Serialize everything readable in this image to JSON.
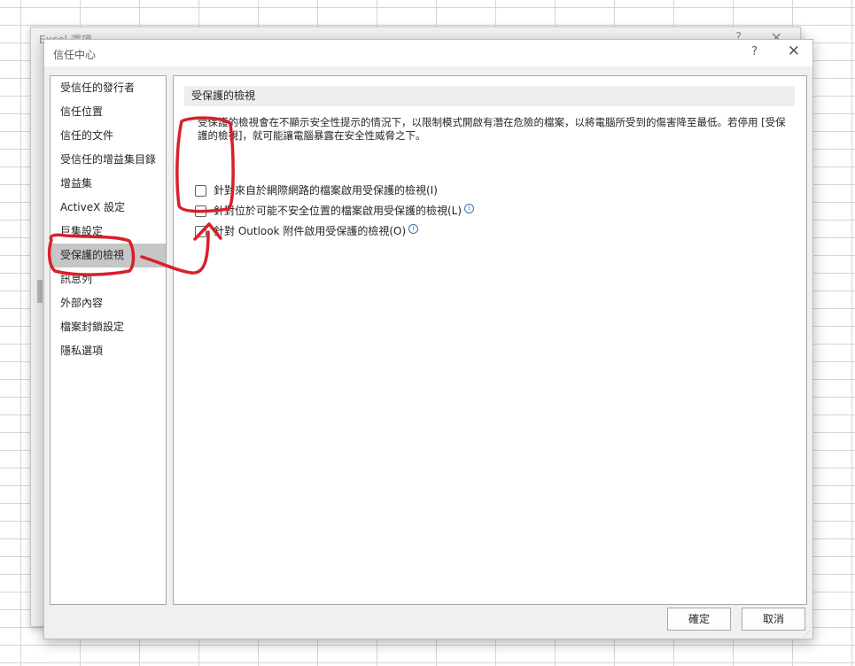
{
  "back_window": {
    "title": "Excel 選項",
    "help_glyph": "?",
    "close_glyph": "✕"
  },
  "dialog": {
    "title": "信任中心",
    "help_glyph": "?",
    "close_glyph": "✕"
  },
  "nav": {
    "items": [
      {
        "label": "受信任的發行者"
      },
      {
        "label": "信任位置"
      },
      {
        "label": "信任的文件"
      },
      {
        "label": "受信任的增益集目錄"
      },
      {
        "label": "增益集"
      },
      {
        "label": "ActiveX 設定"
      },
      {
        "label": "巨集設定"
      },
      {
        "label": "受保護的檢視"
      },
      {
        "label": "訊息列"
      },
      {
        "label": "外部內容"
      },
      {
        "label": "檔案封鎖設定"
      },
      {
        "label": "隱私選項"
      }
    ],
    "active_index": 7
  },
  "content": {
    "section_title": "受保護的檢視",
    "description": "受保護的檢視會在不顯示安全性提示的情況下，以限制模式開啟有潛在危險的檔案，以將電腦所受到的傷害降至最低。若停用 [受保護的檢視]，就可能讓電腦暴露在安全性威脅之下。",
    "options": [
      {
        "label": "針對來自於網際網路的檔案啟用受保護的檢視(I)",
        "checked": false,
        "info": false
      },
      {
        "label": "針對位於可能不安全位置的檔案啟用受保護的檢視(L)",
        "checked": false,
        "info": true
      },
      {
        "label": "針對 Outlook 附件啟用受保護的檢視(O)",
        "checked": false,
        "info": true
      }
    ]
  },
  "footer": {
    "ok_label": "確定",
    "cancel_label": "取消"
  },
  "colors": {
    "annotation_red": "#d8202a",
    "active_nav_bg": "#c6c6c6",
    "info_icon": "#3c6fb0"
  }
}
